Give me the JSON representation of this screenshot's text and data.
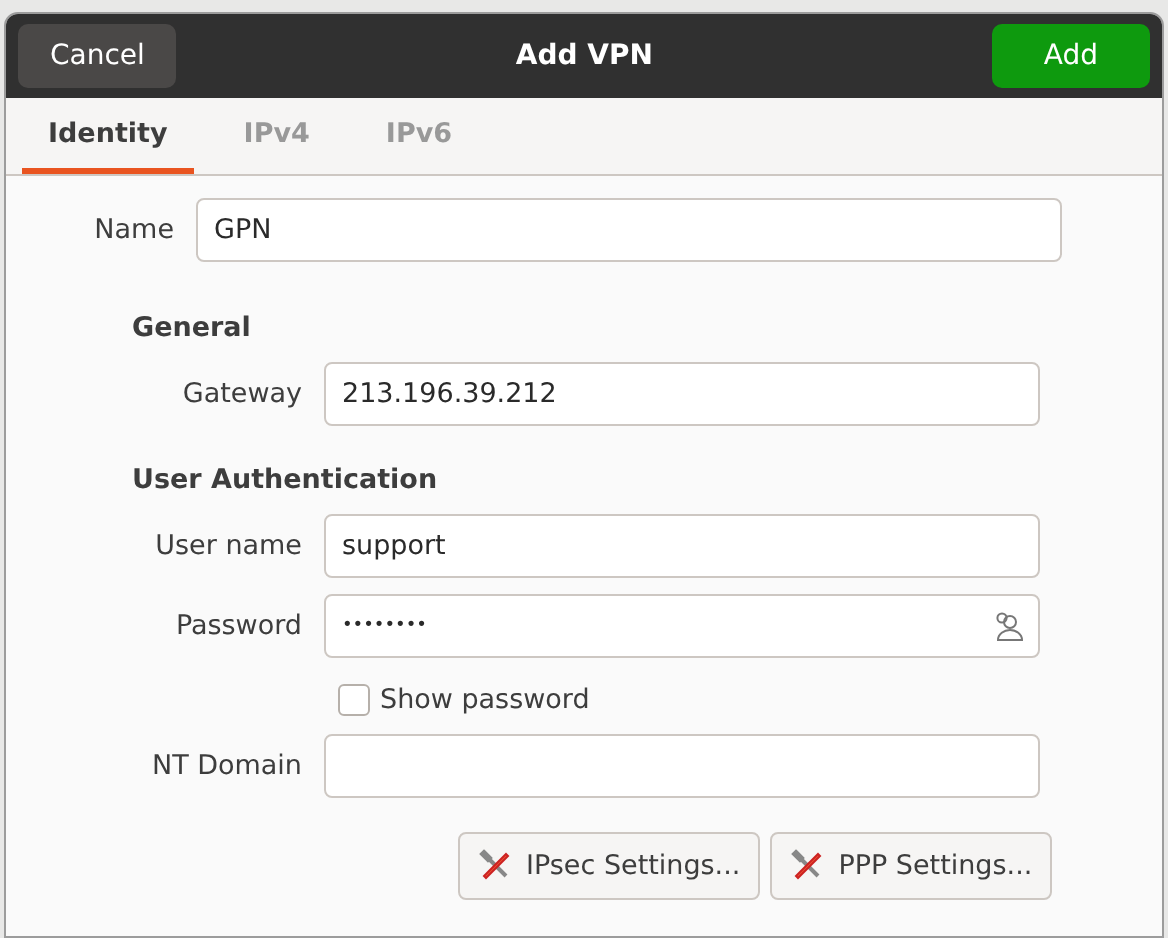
{
  "window": {
    "title": "Add VPN"
  },
  "header_buttons": [
    {
      "label": "Cancel",
      "kind": "cancel"
    },
    {
      "label": "Add",
      "kind": "suggested"
    }
  ],
  "tabs": [
    {
      "label": "Identity",
      "selected": true
    },
    {
      "label": "IPv4",
      "selected": false
    },
    {
      "label": "IPv6",
      "selected": false
    }
  ],
  "name_field": {
    "label": "Name",
    "value": "GPN"
  },
  "sections": [
    {
      "heading": "General",
      "fields": [
        {
          "label": "Gateway",
          "value": "213.196.39.212"
        }
      ]
    },
    {
      "heading": "User Authentication",
      "fields": [
        {
          "label": "User name",
          "value": "support"
        },
        {
          "label": "Password",
          "value": "••••••••",
          "kind": "password"
        }
      ],
      "show_password": {
        "label": "Show password",
        "checked": false
      },
      "after_fields": [
        {
          "label": "NT Domain"
        }
      ]
    }
  ],
  "buttons": [
    {
      "label": "IPsec Settings..."
    },
    {
      "label": "PPP Settings..."
    }
  ]
}
